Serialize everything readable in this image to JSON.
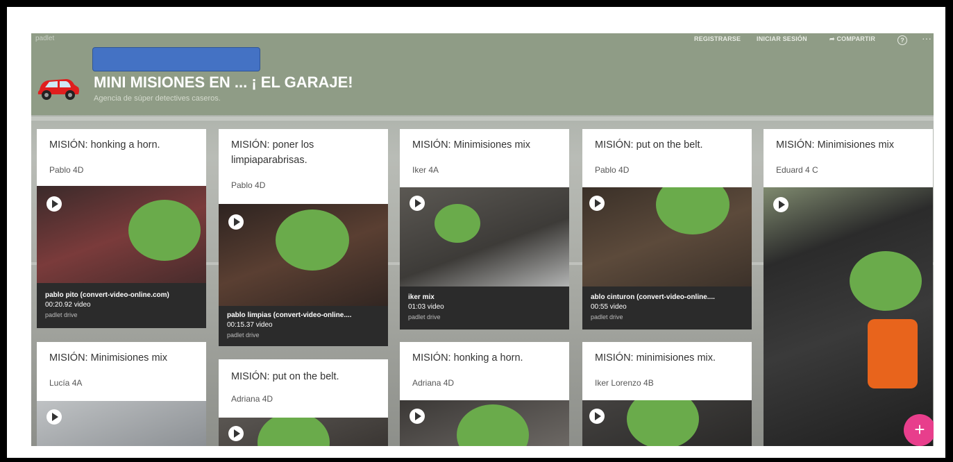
{
  "header": {
    "brand": "padlet",
    "nav": {
      "register": "REGISTRARSE",
      "login": "INICIAR SESIÓN",
      "share": "COMPARTIR"
    },
    "title": "MINI MISIONES EN ... ¡ EL GARAJE!",
    "subtitle": "Agencia de súper detectives caseros."
  },
  "posts": [
    {
      "mission": "MISIÓN: honking a horn.",
      "author": "Pablo 4D",
      "video": {
        "name": "pablo pito (convert-video-online.com)",
        "duration": "00:20.92 video",
        "source": "padlet drive"
      }
    },
    {
      "mission": "MISIÓN: poner los limpiaparabrisas.",
      "author": "Pablo 4D",
      "video": {
        "name": "pablo limpias (convert-video-online....",
        "duration": "00:15.37 video",
        "source": "padlet drive"
      }
    },
    {
      "mission": "MISIÓN: Minimisiones mix",
      "author": "Iker 4A",
      "video": {
        "name": "iker mix",
        "duration": "01:03 video",
        "source": "padlet drive"
      }
    },
    {
      "mission": "MISIÓN: put on the belt.",
      "author": "Pablo 4D",
      "video": {
        "name": "ablo cinturon (convert-video-online....",
        "duration": "00:55 video",
        "source": "padlet drive"
      }
    },
    {
      "mission": "MISIÓN: Minimisiones mix",
      "author": "Eduard 4 C"
    },
    {
      "mission": "MISIÓN: Minimisiones mix",
      "author": "Lucía 4A"
    },
    {
      "mission": "MISIÓN: put on the belt.",
      "author": "Adriana 4D"
    },
    {
      "mission": "MISIÓN: honking a horn.",
      "author": "Adriana 4D"
    },
    {
      "mission": "MISIÓN: minimisiones mix.",
      "author": "Iker Lorenzo 4B"
    }
  ],
  "fab": "+"
}
